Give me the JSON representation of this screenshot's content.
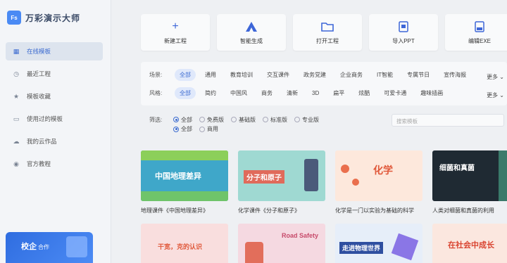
{
  "app": {
    "logo_text": "Fs",
    "title": "万彩演示大师"
  },
  "sidebar": {
    "items": [
      {
        "label": "在线模板",
        "icon": "grid-icon",
        "active": true
      },
      {
        "label": "最近工程",
        "icon": "clock-icon"
      },
      {
        "label": "模板收藏",
        "icon": "star-icon"
      },
      {
        "label": "使用过的模板",
        "icon": "monitor-icon"
      },
      {
        "label": "我的云作品",
        "icon": "cloud-icon"
      },
      {
        "label": "官方教程",
        "icon": "play-circle-icon"
      }
    ],
    "promo": {
      "title": "校企",
      "subtitle": "合作"
    }
  },
  "actions": [
    {
      "label": "新建工程",
      "icon": "plus-icon"
    },
    {
      "label": "智能生成",
      "icon": "ai-logo-icon"
    },
    {
      "label": "打开工程",
      "icon": "folder-icon"
    },
    {
      "label": "导入PPT",
      "icon": "ppt-icon"
    },
    {
      "label": "编辑EXE",
      "icon": "exe-icon"
    }
  ],
  "filters": {
    "scene": {
      "label": "场景:",
      "options": [
        "全部",
        "通用",
        "教育培训",
        "交互课件",
        "政务党建",
        "企业商务",
        "IT智能",
        "专属节日",
        "宣传海报"
      ],
      "selected": "全部"
    },
    "style": {
      "label": "风格:",
      "options": [
        "全部",
        "简约",
        "中国风",
        "商务",
        "清新",
        "3D",
        "扁平",
        "炫酷",
        "可爱卡通",
        "趣味插画"
      ],
      "selected": "全部"
    },
    "more_label": "更多",
    "screen": {
      "label": "筛选:",
      "row1": [
        "全部",
        "免费版",
        "基础版",
        "标准版",
        "专业版"
      ],
      "row2": [
        "全部",
        "商用"
      ]
    },
    "search_placeholder": "搜索模板"
  },
  "cards": [
    {
      "thumb_title": "中国地理差异",
      "caption": "地理课件《中国地理差异》",
      "bg": "#3fa7c9"
    },
    {
      "thumb_title": "分子和原子",
      "caption": "化学课件《分子和原子》",
      "bg": "#9fd9d2"
    },
    {
      "thumb_title": "化学",
      "caption": "化学是一门以实验为基础的科学",
      "bg": "#fde8dc"
    },
    {
      "thumb_title": "细菌和真菌",
      "caption": "人类对细菌和真菌的利用",
      "bg": "#1f2a33"
    },
    {
      "thumb_title": "干宽，克的认识",
      "caption": "",
      "bg": "#f9dede"
    },
    {
      "thumb_title": "Road Safety",
      "caption": "",
      "bg": "#f5d9e1"
    },
    {
      "thumb_title": "走进物理世界",
      "caption": "",
      "bg": "#e6eef9"
    },
    {
      "thumb_title": "在社会中成长",
      "caption": "",
      "bg": "#fbe7df"
    }
  ]
}
